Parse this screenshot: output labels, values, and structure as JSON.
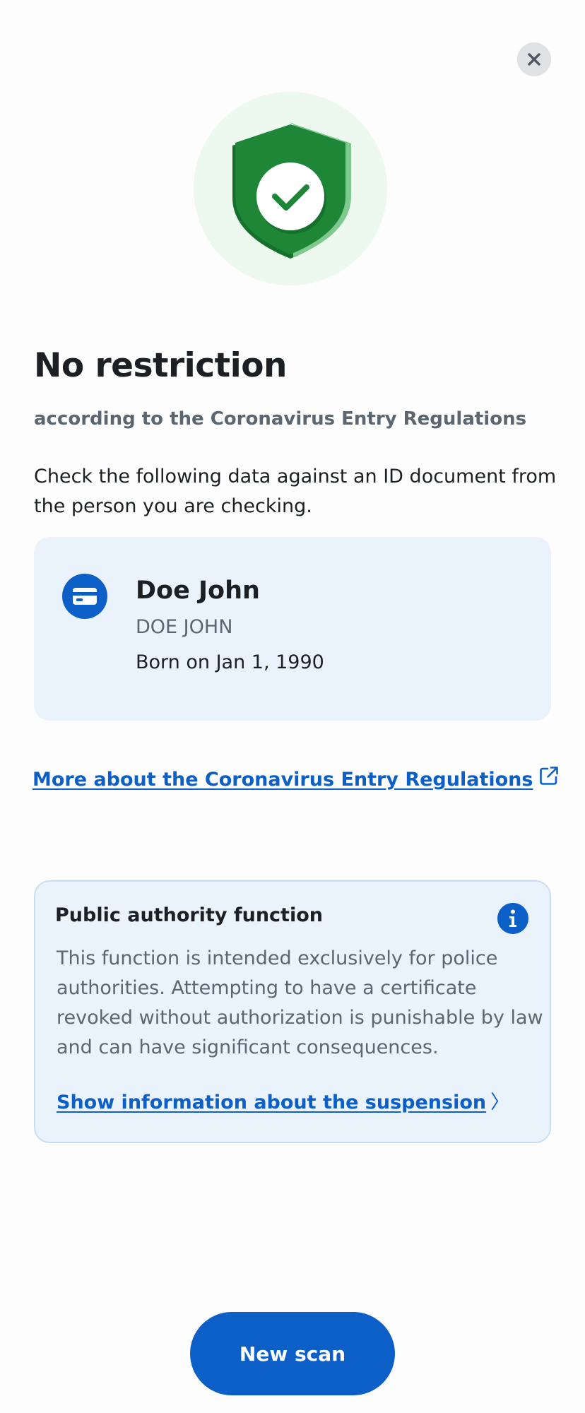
{
  "header": {
    "close_icon": "close-icon"
  },
  "status": {
    "icon": "shield-check-icon",
    "title": "No restriction",
    "subtitle": "according to the Coronavirus Entry Regulations",
    "description": "Check the following data against an ID document from the person you are checking."
  },
  "person": {
    "icon": "id-card-icon",
    "name": "Doe John",
    "machine_name": "DOE JOHN",
    "birth": "Born on Jan 1, 1990"
  },
  "links": {
    "more_label": "More about the Coronavirus Entry Regulations",
    "more_icon": "external-link-icon"
  },
  "authority": {
    "title": "Public authority function",
    "info_icon": "info-icon",
    "text": "This function is intended exclusively for police authorities. Attempting to have a certificate revoked without authorization is punishable by law and can have significant consequences.",
    "link_label": "Show information about the suspension",
    "link_chevron": "〉"
  },
  "actions": {
    "new_scan_label": "New scan"
  },
  "colors": {
    "accent": "#0b5fc6",
    "success": "#1e8737",
    "success_bg": "#edf8ef",
    "card_bg": "#eaf2fc",
    "muted_text": "#5b6671"
  }
}
